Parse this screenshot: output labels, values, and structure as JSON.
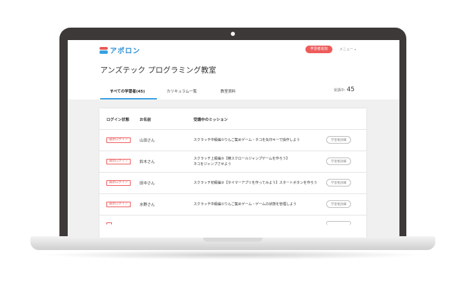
{
  "header": {
    "logo_text": "アポロン",
    "logout_label": "学習者追加",
    "menu_label": "メニュー",
    "menu_caret": "▾"
  },
  "page": {
    "title": "アンズテック プログラミング教室"
  },
  "tabs": [
    {
      "label": "すべての学習者(45)",
      "active": true
    },
    {
      "label": "カリキュラム一覧",
      "active": false
    },
    {
      "label": "教室資料",
      "active": false
    }
  ],
  "count": {
    "label": "受講中:",
    "value": "45"
  },
  "table": {
    "headers": {
      "status": "ログイン状態",
      "name": "お名前",
      "mission": "受講中のミッション"
    },
    "detail_label": "学習者詳細",
    "rows": [
      {
        "status": "最新ログイン",
        "name": "山田さん",
        "mission_line1": "スクラッチ中級編①りんご集めゲーム・ネコを矢印キーで操作しよう",
        "mission_line2": ""
      },
      {
        "status": "最新ログイン",
        "name": "鈴木さん",
        "mission_line1": "スクラッチ上級編③【横スクロールジャンプゲームを作ろう】",
        "mission_line2": "ネコをジャンプさせよう"
      },
      {
        "status": "最新ログイン",
        "name": "田中さん",
        "mission_line1": "スクラッチ初級編③【タイマーアプリを作ってみよう】スタートボタンを作ろう",
        "mission_line2": ""
      },
      {
        "status": "最新ログイン",
        "name": "水野さん",
        "mission_line1": "スクラッチ中級編①りんご集めゲーム・ゲームの状態を管理しよう",
        "mission_line2": ""
      },
      {
        "status": "",
        "name": "",
        "mission_line1": "",
        "mission_line2": ""
      }
    ]
  }
}
